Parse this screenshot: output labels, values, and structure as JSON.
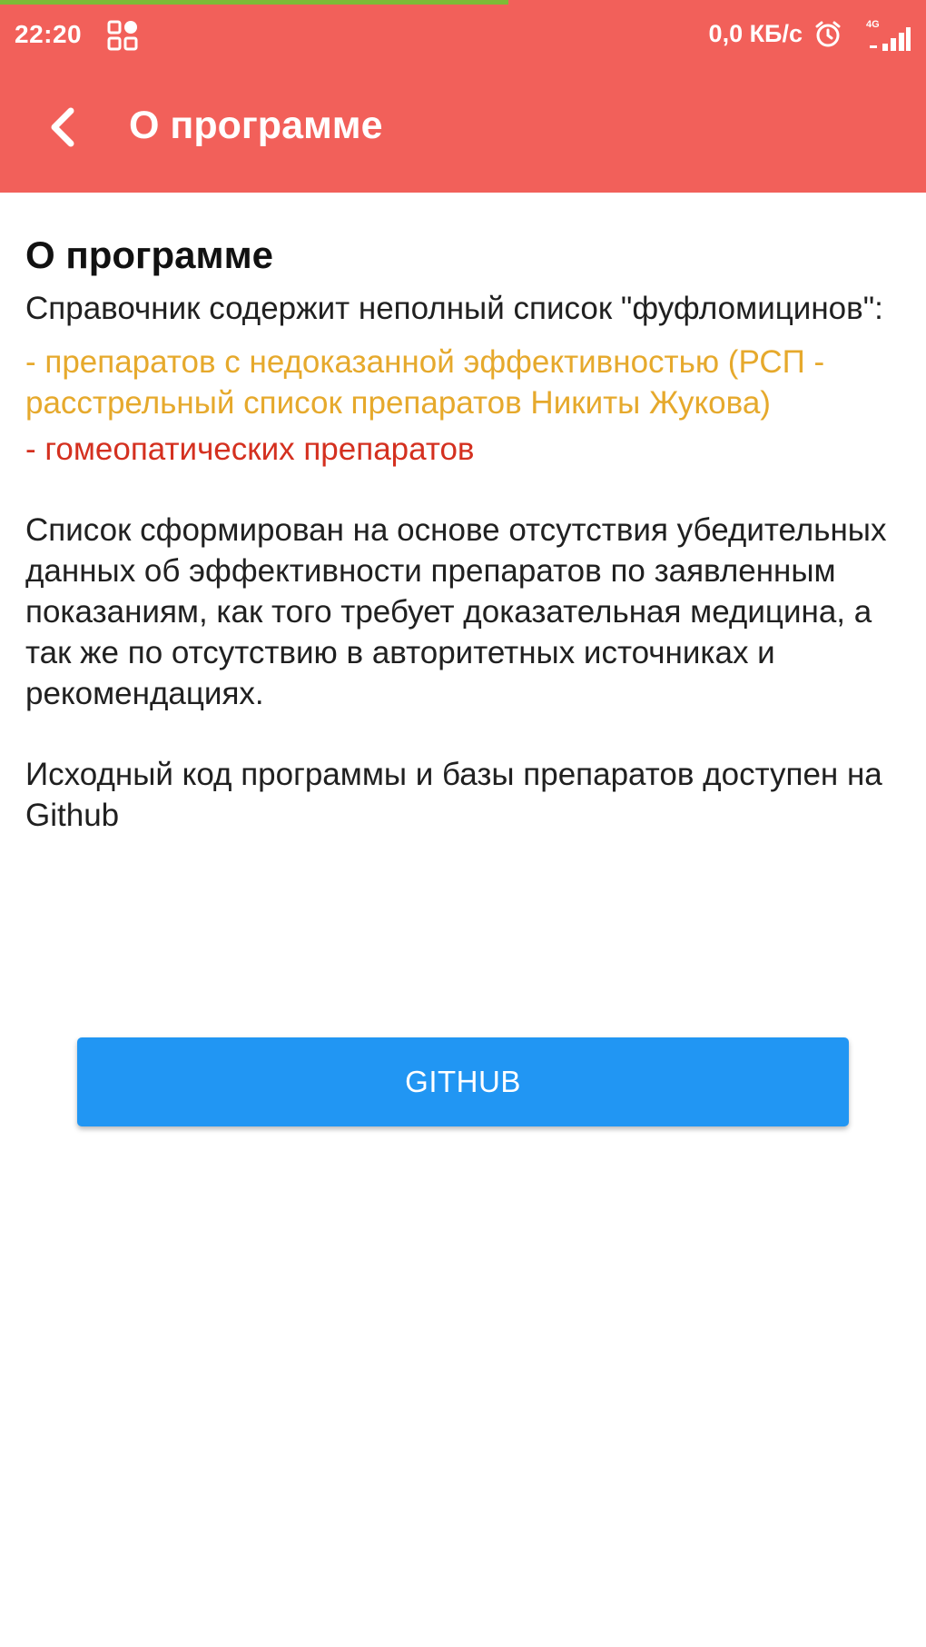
{
  "status_bar": {
    "time": "22:20",
    "network_speed": "0,0 КБ/с",
    "network_type": "4G"
  },
  "app_bar": {
    "title": "О программе",
    "back_icon": "chevron-left-icon"
  },
  "content": {
    "title": "О программе",
    "intro": "Справочник содержит неполный список \"фуфломицинов\":",
    "item_unproven": "- препаратов с недоказанной эффективностью (РСП - расстрельный список препаратов Никиты Жукова)",
    "item_homeopathic": "- гомеопатических препаратов",
    "basis": "Список сформирован на основе отсутствия убедительных данных об эффективности препаратов по заявленным показаниям, как того требует доказательная медицина, а так же по отсутствию в авторитетных источниках и рекомендациях.",
    "source_note": "Исходный код программы и базы препаратов доступен на Github",
    "github_button_label": "GITHUB"
  },
  "colors": {
    "appbar": "#f2605a",
    "unproven_text": "#e6a92c",
    "homeopathic_text": "#d4301f",
    "button": "#2196f3"
  }
}
